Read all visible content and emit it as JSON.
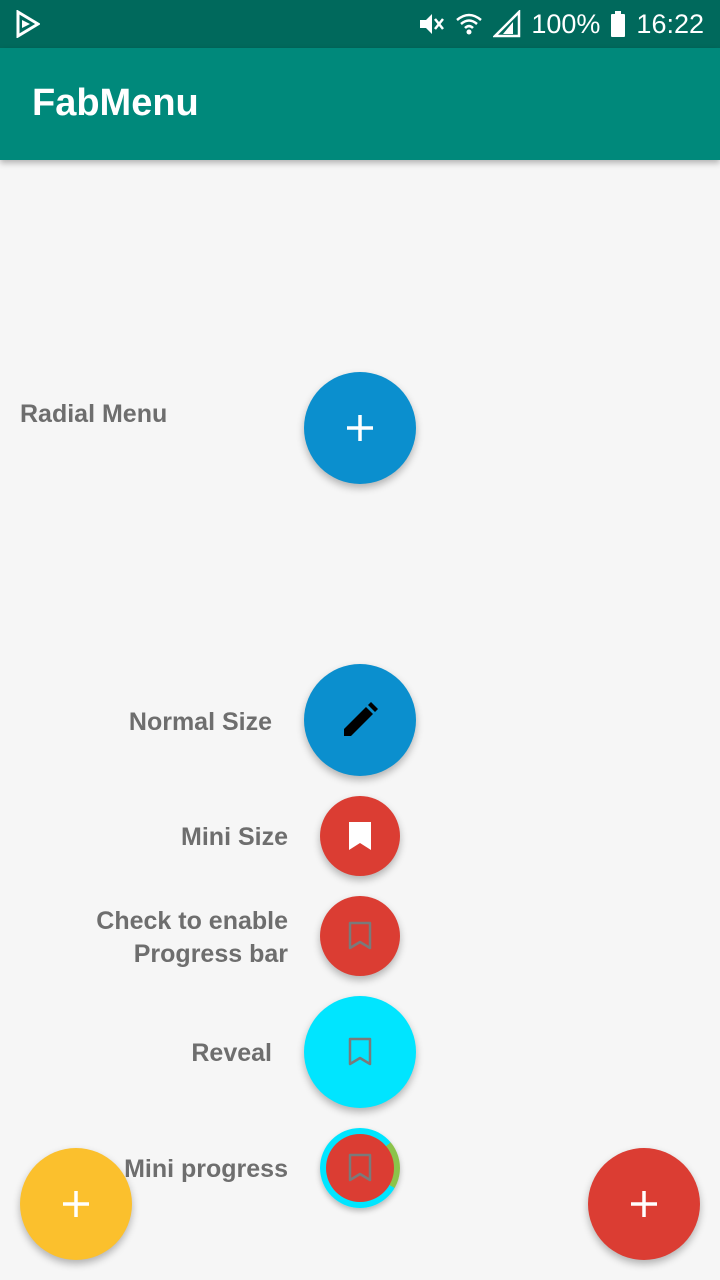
{
  "status_bar": {
    "battery_percent": "100%",
    "time": "16:22",
    "icons": [
      "play-store-notification-icon",
      "mute-icon",
      "wifi-icon",
      "signal-icon",
      "battery-icon"
    ]
  },
  "app_bar": {
    "title": "FabMenu"
  },
  "labels": {
    "radial_menu": "Radial Menu",
    "normal_size": "Normal Size",
    "mini_size": "Mini Size",
    "check_line1": "Check to enable",
    "check_line2": "Progress bar",
    "reveal": "Reveal",
    "mini_progress": "Mini progress"
  },
  "fabs": {
    "radial_menu": {
      "icon": "plus-icon",
      "color": "#0b8fce"
    },
    "normal_size": {
      "icon": "pencil-icon",
      "color": "#0b8fce"
    },
    "mini_size": {
      "icon": "bookmark-filled-icon",
      "color": "#db3d33"
    },
    "progress_toggle": {
      "icon": "bookmark-outline-icon",
      "color": "#db3d33"
    },
    "reveal": {
      "icon": "bookmark-outline-icon",
      "color": "#00e5ff"
    },
    "mini_progress": {
      "icon": "bookmark-outline-icon",
      "color": "#db3d33",
      "ring_color": "#00e5ff",
      "progress_color": "#8bc34a"
    },
    "bottom_left": {
      "icon": "plus-icon",
      "color": "#fbc02d"
    },
    "bottom_right": {
      "icon": "plus-icon",
      "color": "#db3d33"
    }
  }
}
